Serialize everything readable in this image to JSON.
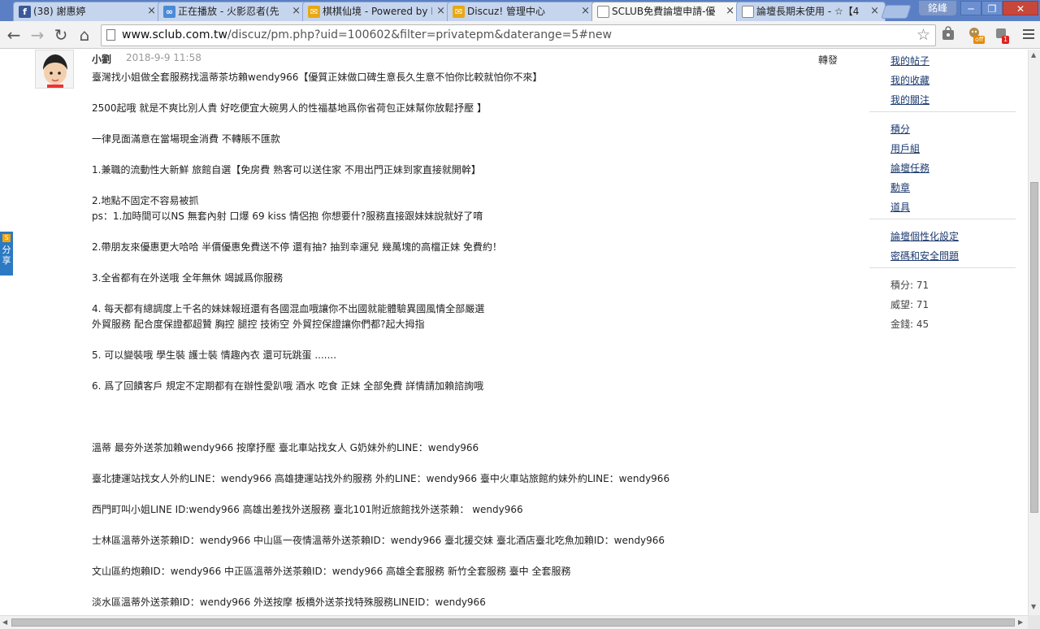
{
  "tabs": [
    {
      "label": "(38) 謝惠婷",
      "icon": "f",
      "color": "#3b5998"
    },
    {
      "label": "正在播放 - 火影忍者(先",
      "icon": "∞",
      "color": "#4a8bd6"
    },
    {
      "label": "棋棋仙境 - Powered by D",
      "icon": "✉",
      "color": "#e8a815"
    },
    {
      "label": "Discuz! 管理中心",
      "icon": "✉",
      "color": "#e8a815"
    },
    {
      "label": "SCLUB免費論壇申請-優",
      "icon": "",
      "color": "#ffffff"
    },
    {
      "label": "論壇長期未使用 - ☆【4",
      "icon": "",
      "color": "#ffffff"
    }
  ],
  "window": {
    "user": "銘峰",
    "minimize": "─",
    "restore": "❐",
    "close": "✕"
  },
  "toolbar": {
    "back": "←",
    "forward": "→",
    "reload": "↻",
    "home": "⌂",
    "url_domain": "www.sclub.com.tw",
    "url_path": "/discuz/pm.php?uid=100602&filter=privatepm&daterange=5#new",
    "star": "☆",
    "ext_off": "off",
    "ext_count": "1"
  },
  "post": {
    "author": "小劉",
    "time": "2018-9-9 11:58",
    "forward": "轉發",
    "lines": [
      "臺灣找小姐做全套服務找溫蒂茶坊賴wendy966【優質正妹做口碑生意長久生意不怕你比較就怕你不來】",
      "",
      "2500起哦 就是不爽比別人貴 好吃便宜大碗男人的性福基地爲你省荷包正妹幫你放鬆抒壓 】",
      "",
      "一律見面滿意在當場現金消費 不轉賬不匯款",
      "",
      "1.兼職的流動性大新鮮 旅館自選【免房費 熟客可以送住家 不用出門正妹到家直接就開幹】",
      "",
      "2.地點不固定不容易被抓",
      "ps：1.加時間可以NS 無套內射 口爆 69  kiss  情侶抱  你想要什?服務直接跟妹妹說就好了唷",
      "",
      "2.帶朋友來優惠更大哈哈  半價優惠免費送不停  還有抽? 抽到幸運兒  幾萬塊的高檔正妹 免費約！",
      "",
      "3.全省都有在外送哦 全年無休 竭誠爲你服務",
      "",
      "4. 每天都有總調度上千名的妹妹報班還有各國混血哦讓你不出國就能體驗異國風情全部嚴選",
      "外貿服務  配合度保證都超贊  胸控  腿控 技術空  外貿控保證讓你們都?起大拇指",
      "",
      "5. 可以變裝哦  學生裝  護士裝  情趣內衣 還可玩跳蛋 .......",
      "",
      "6. 爲了回饋客戶  規定不定期都有在辦性愛趴哦   酒水 吃食  正妹 全部免費  詳情請加賴諮詢哦",
      "",
      "",
      "",
      "溫蒂 最夯外送茶加賴wendy966 按摩抒壓 臺北車站找女人 G奶妹外約LINE：wendy966",
      "",
      "臺北捷運站找女人外約LINE：wendy966  高雄捷運站找外約服務 外約LINE：wendy966  臺中火車站旅館約妹外約LINE：wendy966",
      "",
      "西門町叫小姐LINE ID:wendy966 高雄出差找外送服務  臺北101附近旅館找外送茶賴： wendy966",
      "",
      "士林區溫蒂外送茶賴ID：wendy966   中山區一夜情溫蒂外送茶賴ID：wendy966 臺北援交妹 臺北酒店臺北吃魚加賴ID：wendy966",
      "",
      "文山區約炮賴ID：wendy966  中正區溫蒂外送茶賴ID：wendy966  高雄全套服務  新竹全套服務 臺中 全套服務",
      "",
      "淡水區溫蒂外送茶賴ID：wendy966 外送按摩  板橋外送茶找特殊服務LINEID：wendy966"
    ]
  },
  "sidebar": {
    "group1": [
      "我的帖子",
      "我的收藏",
      "我的關注"
    ],
    "group2": [
      "積分",
      "用戶組",
      "論壇任務",
      "勳章",
      "道具"
    ],
    "group3": [
      "論壇個性化設定",
      "密碼和安全問題"
    ],
    "stats": [
      "積分: 71",
      "威望: 71",
      "金錢: 45"
    ]
  },
  "share": {
    "label1": "分",
    "label2": "享",
    "icon": "S"
  },
  "scroll": {
    "up": "▲",
    "down": "▼",
    "left": "◀",
    "right": "▶"
  }
}
